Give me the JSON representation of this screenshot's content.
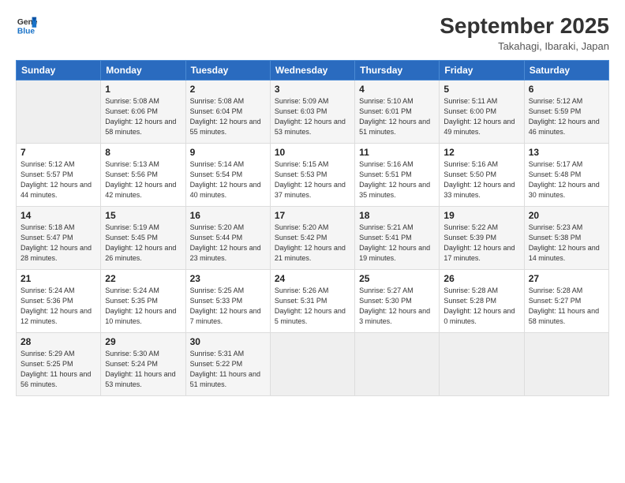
{
  "logo": {
    "line1": "General",
    "line2": "Blue"
  },
  "title": "September 2025",
  "location": "Takahagi, Ibaraki, Japan",
  "weekdays": [
    "Sunday",
    "Monday",
    "Tuesday",
    "Wednesday",
    "Thursday",
    "Friday",
    "Saturday"
  ],
  "weeks": [
    [
      {
        "day": "",
        "empty": true
      },
      {
        "day": "1",
        "sunrise": "5:08 AM",
        "sunset": "6:06 PM",
        "daylight": "12 hours and 58 minutes."
      },
      {
        "day": "2",
        "sunrise": "5:08 AM",
        "sunset": "6:04 PM",
        "daylight": "12 hours and 55 minutes."
      },
      {
        "day": "3",
        "sunrise": "5:09 AM",
        "sunset": "6:03 PM",
        "daylight": "12 hours and 53 minutes."
      },
      {
        "day": "4",
        "sunrise": "5:10 AM",
        "sunset": "6:01 PM",
        "daylight": "12 hours and 51 minutes."
      },
      {
        "day": "5",
        "sunrise": "5:11 AM",
        "sunset": "6:00 PM",
        "daylight": "12 hours and 49 minutes."
      },
      {
        "day": "6",
        "sunrise": "5:12 AM",
        "sunset": "5:59 PM",
        "daylight": "12 hours and 46 minutes."
      }
    ],
    [
      {
        "day": "7",
        "sunrise": "5:12 AM",
        "sunset": "5:57 PM",
        "daylight": "12 hours and 44 minutes."
      },
      {
        "day": "8",
        "sunrise": "5:13 AM",
        "sunset": "5:56 PM",
        "daylight": "12 hours and 42 minutes."
      },
      {
        "day": "9",
        "sunrise": "5:14 AM",
        "sunset": "5:54 PM",
        "daylight": "12 hours and 40 minutes."
      },
      {
        "day": "10",
        "sunrise": "5:15 AM",
        "sunset": "5:53 PM",
        "daylight": "12 hours and 37 minutes."
      },
      {
        "day": "11",
        "sunrise": "5:16 AM",
        "sunset": "5:51 PM",
        "daylight": "12 hours and 35 minutes."
      },
      {
        "day": "12",
        "sunrise": "5:16 AM",
        "sunset": "5:50 PM",
        "daylight": "12 hours and 33 minutes."
      },
      {
        "day": "13",
        "sunrise": "5:17 AM",
        "sunset": "5:48 PM",
        "daylight": "12 hours and 30 minutes."
      }
    ],
    [
      {
        "day": "14",
        "sunrise": "5:18 AM",
        "sunset": "5:47 PM",
        "daylight": "12 hours and 28 minutes."
      },
      {
        "day": "15",
        "sunrise": "5:19 AM",
        "sunset": "5:45 PM",
        "daylight": "12 hours and 26 minutes."
      },
      {
        "day": "16",
        "sunrise": "5:20 AM",
        "sunset": "5:44 PM",
        "daylight": "12 hours and 23 minutes."
      },
      {
        "day": "17",
        "sunrise": "5:20 AM",
        "sunset": "5:42 PM",
        "daylight": "12 hours and 21 minutes."
      },
      {
        "day": "18",
        "sunrise": "5:21 AM",
        "sunset": "5:41 PM",
        "daylight": "12 hours and 19 minutes."
      },
      {
        "day": "19",
        "sunrise": "5:22 AM",
        "sunset": "5:39 PM",
        "daylight": "12 hours and 17 minutes."
      },
      {
        "day": "20",
        "sunrise": "5:23 AM",
        "sunset": "5:38 PM",
        "daylight": "12 hours and 14 minutes."
      }
    ],
    [
      {
        "day": "21",
        "sunrise": "5:24 AM",
        "sunset": "5:36 PM",
        "daylight": "12 hours and 12 minutes."
      },
      {
        "day": "22",
        "sunrise": "5:24 AM",
        "sunset": "5:35 PM",
        "daylight": "12 hours and 10 minutes."
      },
      {
        "day": "23",
        "sunrise": "5:25 AM",
        "sunset": "5:33 PM",
        "daylight": "12 hours and 7 minutes."
      },
      {
        "day": "24",
        "sunrise": "5:26 AM",
        "sunset": "5:31 PM",
        "daylight": "12 hours and 5 minutes."
      },
      {
        "day": "25",
        "sunrise": "5:27 AM",
        "sunset": "5:30 PM",
        "daylight": "12 hours and 3 minutes."
      },
      {
        "day": "26",
        "sunrise": "5:28 AM",
        "sunset": "5:28 PM",
        "daylight": "12 hours and 0 minutes."
      },
      {
        "day": "27",
        "sunrise": "5:28 AM",
        "sunset": "5:27 PM",
        "daylight": "11 hours and 58 minutes."
      }
    ],
    [
      {
        "day": "28",
        "sunrise": "5:29 AM",
        "sunset": "5:25 PM",
        "daylight": "11 hours and 56 minutes."
      },
      {
        "day": "29",
        "sunrise": "5:30 AM",
        "sunset": "5:24 PM",
        "daylight": "11 hours and 53 minutes."
      },
      {
        "day": "30",
        "sunrise": "5:31 AM",
        "sunset": "5:22 PM",
        "daylight": "11 hours and 51 minutes."
      },
      {
        "day": "",
        "empty": true
      },
      {
        "day": "",
        "empty": true
      },
      {
        "day": "",
        "empty": true
      },
      {
        "day": "",
        "empty": true
      }
    ]
  ]
}
